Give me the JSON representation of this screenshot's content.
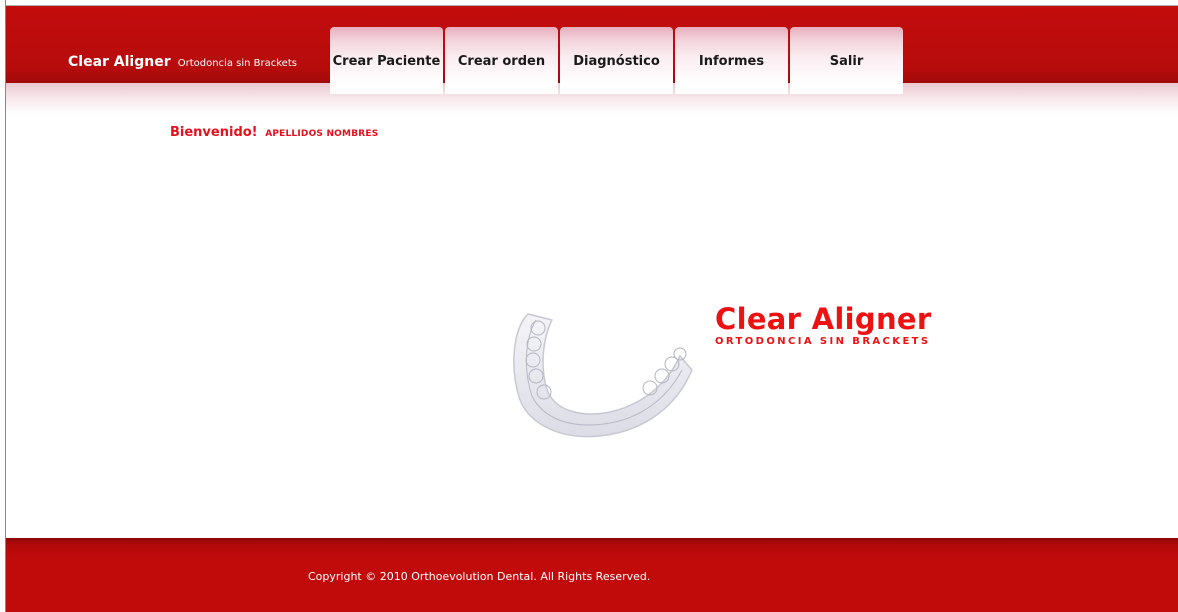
{
  "header": {
    "brand_name": "Clear Aligner",
    "brand_tagline": "Ortodoncia sin Brackets"
  },
  "nav": {
    "items": [
      {
        "label": "Crear Paciente"
      },
      {
        "label": "Crear orden"
      },
      {
        "label": "Diagnóstico"
      },
      {
        "label": "Informes"
      },
      {
        "label": "Salir"
      }
    ]
  },
  "welcome": {
    "greeting": "Bienvenido!",
    "user_name": "APELLIDOS NOMBRES"
  },
  "logo": {
    "title": "Clear Aligner",
    "subtitle": "ORTODONCIA SIN BRACKETS"
  },
  "footer": {
    "copyright": "Copyright © 2010 Orthoevolution Dental. All Rights Reserved."
  },
  "colors": {
    "header_red": "#c30c0c",
    "accent_red": "#ee1111",
    "welcome_red": "#e4101c",
    "tab_pink": "#f3d4dc"
  }
}
